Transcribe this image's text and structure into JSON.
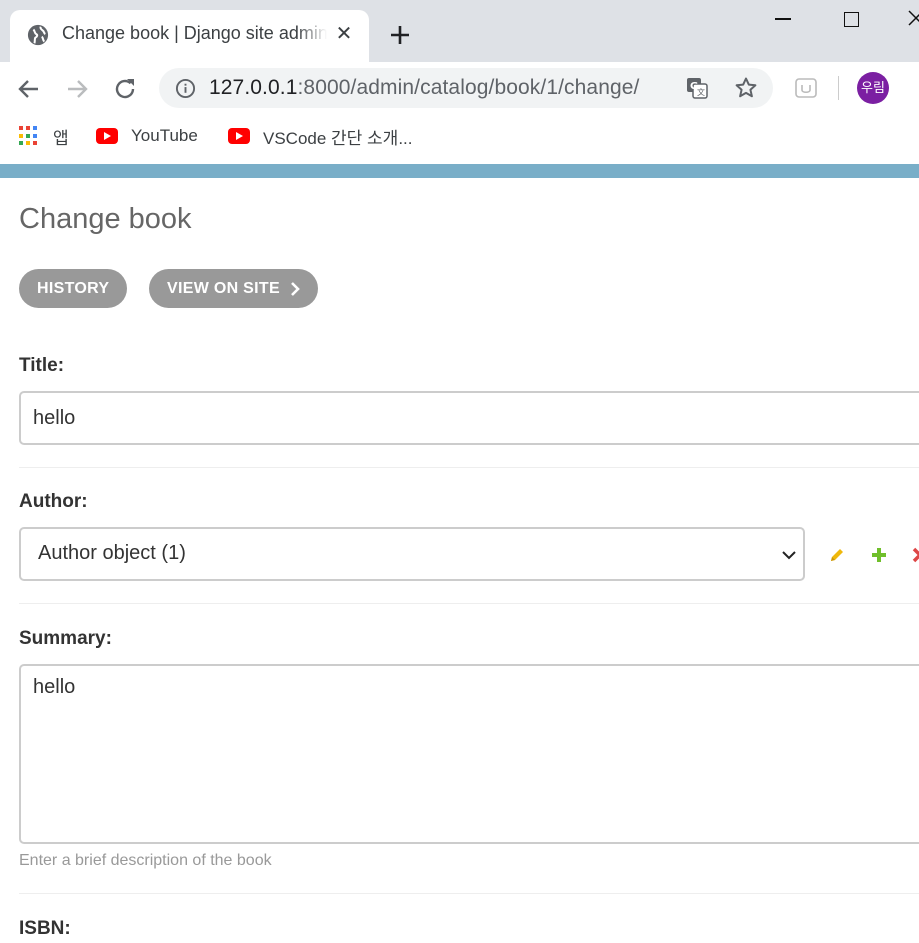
{
  "browser": {
    "tab": {
      "title": "Change book | Django site admin",
      "close_label": "✕"
    },
    "url": {
      "host": "127.0.0.1",
      "path": ":8000/admin/catalog/book/1/change/"
    },
    "profile_avatar": "우림",
    "bookmarks": [
      {
        "label": "앱",
        "icon": "apps-grid-icon"
      },
      {
        "label": "YouTube",
        "icon": "youtube-icon"
      },
      {
        "label": "VSCode 간단 소개...",
        "icon": "youtube-icon"
      }
    ],
    "colors": {
      "tabbar": "#dee1e6",
      "omnibox": "#f1f3f4",
      "avatar": "#7b1fa2"
    }
  },
  "admin": {
    "page_title": "Change book",
    "object_tools": {
      "history": "HISTORY",
      "view_on_site": "VIEW ON SITE"
    },
    "fields": {
      "title": {
        "label": "Title:",
        "value": "hello"
      },
      "author": {
        "label": "Author:",
        "selected": "Author object (1)"
      },
      "summary": {
        "label": "Summary:",
        "value": "hello",
        "help": "Enter a brief description of the book"
      },
      "isbn": {
        "label": "ISBN:"
      }
    },
    "colors": {
      "header": "#79aec8",
      "button": "#999999",
      "change_icon": "#efb80b",
      "add_icon": "#70bf2b",
      "delete_icon": "#dd4646"
    }
  }
}
